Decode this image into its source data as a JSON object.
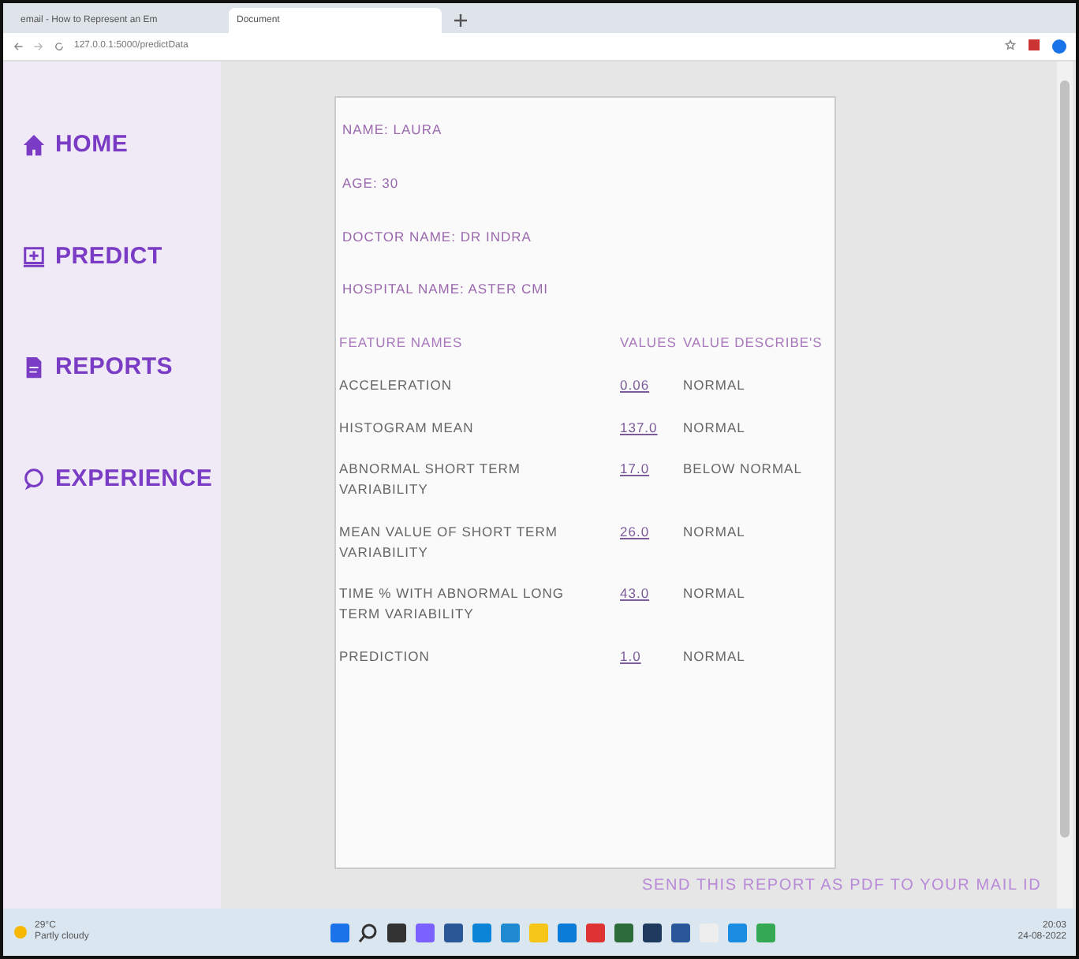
{
  "browser": {
    "tabs": [
      {
        "title": "email - How to Represent an Em",
        "selected": false
      },
      {
        "title": "Document",
        "selected": true
      }
    ],
    "url": "127.0.0.1:5000/predictData"
  },
  "sidebar": {
    "items": [
      {
        "label": "HOME"
      },
      {
        "label": "PREDICT"
      },
      {
        "label": "REPORTS"
      },
      {
        "label": "EXPERIENCE"
      }
    ]
  },
  "report": {
    "details": [
      "NAME:  LAURA",
      "AGE:  30",
      "DOCTOR NAME:  DR INDRA",
      "HOSPITAL NAME:  ASTER CMI"
    ],
    "columns": [
      "FEATURE NAMES",
      "VALUES",
      "VALUE DESCRIBE'S"
    ],
    "rows": [
      {
        "feature": "ACCELERATION",
        "value": "0.06",
        "describe": "NORMAL"
      },
      {
        "feature": "HISTOGRAM MEAN",
        "value": "137.0",
        "describe": "NORMAL"
      },
      {
        "feature": "ABNORMAL SHORT TERM VARIABILITY",
        "value": "17.0",
        "describe": "BELOW NORMAL"
      },
      {
        "feature": "MEAN VALUE OF SHORT TERM VARIABILITY",
        "value": "26.0",
        "describe": "NORMAL"
      },
      {
        "feature": "TIME % WITH ABNORMAL LONG TERM VARIABILITY",
        "value": "43.0",
        "describe": "NORMAL"
      },
      {
        "feature": "PREDICTION",
        "value": "1.0",
        "describe": "NORMAL"
      }
    ]
  },
  "send_link": "SEND THIS REPORT AS PDF TO YOUR MAIL ID",
  "taskbar": {
    "weather_temp": "29°C",
    "weather_text": "Partly cloudy",
    "time": "20:03",
    "date": "24-08-2022"
  }
}
